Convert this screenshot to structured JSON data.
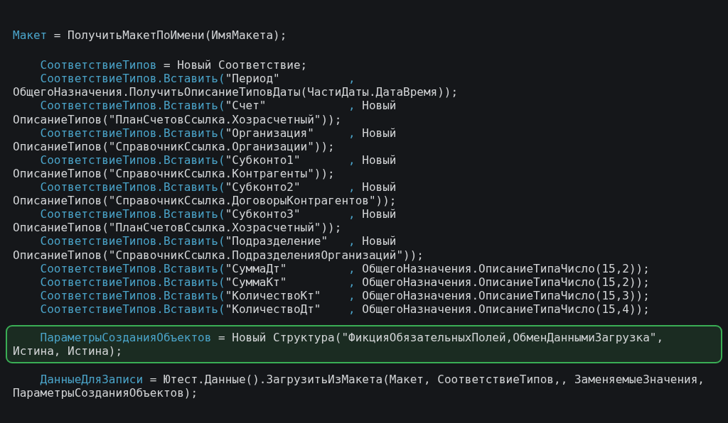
{
  "code_blocks": [
    {
      "highlighted": false,
      "lines": [
        {
          "indent": false,
          "segments": [
            {
              "kind": "ident",
              "text": "Макет"
            },
            {
              "kind": "plain",
              "text": " = ПолучитьМакетПоИмени(ИмяМакета);"
            }
          ]
        }
      ]
    },
    {
      "highlighted": false,
      "lines": [
        {
          "indent": true,
          "segments": [
            {
              "kind": "ident",
              "text": "СоответствиеТипов"
            },
            {
              "kind": "plain",
              "text": " = Новый Соответствие;"
            }
          ]
        },
        {
          "indent": true,
          "segments": [
            {
              "kind": "ident",
              "text": "СоответствиеТипов.Вставить("
            },
            {
              "kind": "plain",
              "text": "\"Период\"          "
            },
            {
              "kind": "ident",
              "text": ","
            }
          ]
        },
        {
          "indent": false,
          "segments": [
            {
              "kind": "plain",
              "text": "ОбщегоНазначения.ПолучитьОписаниеТиповДаты(ЧастиДаты.ДатаВремя));"
            }
          ]
        },
        {
          "indent": true,
          "segments": [
            {
              "kind": "ident",
              "text": "СоответствиеТипов.Вставить("
            },
            {
              "kind": "plain",
              "text": "\"Счет\"            "
            },
            {
              "kind": "ident",
              "text": ","
            },
            {
              "kind": "plain",
              "text": " Новый"
            }
          ]
        },
        {
          "indent": false,
          "segments": [
            {
              "kind": "plain",
              "text": "ОписаниеТипов(\"ПланСчетовСсылка.Хозрасчетный\"));"
            }
          ]
        },
        {
          "indent": true,
          "segments": [
            {
              "kind": "ident",
              "text": "СоответствиеТипов.Вставить("
            },
            {
              "kind": "plain",
              "text": "\"Организация\"     "
            },
            {
              "kind": "ident",
              "text": ","
            },
            {
              "kind": "plain",
              "text": " Новый"
            }
          ]
        },
        {
          "indent": false,
          "segments": [
            {
              "kind": "plain",
              "text": "ОписаниеТипов(\"СправочникСсылка.Организации\"));"
            }
          ]
        },
        {
          "indent": true,
          "segments": [
            {
              "kind": "ident",
              "text": "СоответствиеТипов.Вставить("
            },
            {
              "kind": "plain",
              "text": "\"Субконто1\"       "
            },
            {
              "kind": "ident",
              "text": ","
            },
            {
              "kind": "plain",
              "text": " Новый"
            }
          ]
        },
        {
          "indent": false,
          "segments": [
            {
              "kind": "plain",
              "text": "ОписаниеТипов(\"СправочникСсылка.Контрагенты\"));"
            }
          ]
        },
        {
          "indent": true,
          "segments": [
            {
              "kind": "ident",
              "text": "СоответствиеТипов.Вставить("
            },
            {
              "kind": "plain",
              "text": "\"Субконто2\"       "
            },
            {
              "kind": "ident",
              "text": ","
            },
            {
              "kind": "plain",
              "text": " Новый"
            }
          ]
        },
        {
          "indent": false,
          "segments": [
            {
              "kind": "plain",
              "text": "ОписаниеТипов(\"СправочникСсылка.ДоговорыКонтрагентов\"));"
            }
          ]
        },
        {
          "indent": true,
          "segments": [
            {
              "kind": "ident",
              "text": "СоответствиеТипов.Вставить("
            },
            {
              "kind": "plain",
              "text": "\"Субконто3\"       "
            },
            {
              "kind": "ident",
              "text": ","
            },
            {
              "kind": "plain",
              "text": " Новый"
            }
          ]
        },
        {
          "indent": false,
          "segments": [
            {
              "kind": "plain",
              "text": "ОписаниеТипов(\"ПланСчетовСсылка.Хозрасчетный\"));"
            }
          ]
        },
        {
          "indent": true,
          "segments": [
            {
              "kind": "ident",
              "text": "СоответствиеТипов.Вставить("
            },
            {
              "kind": "plain",
              "text": "\"Подразделение\"   "
            },
            {
              "kind": "ident",
              "text": ","
            },
            {
              "kind": "plain",
              "text": " Новый"
            }
          ]
        },
        {
          "indent": false,
          "segments": [
            {
              "kind": "plain",
              "text": "ОписаниеТипов(\"СправочникСсылка.ПодразделенияОрганизаций\"));"
            }
          ]
        },
        {
          "indent": true,
          "segments": [
            {
              "kind": "ident",
              "text": "СоответствиеТипов.Вставить("
            },
            {
              "kind": "plain",
              "text": "\"СуммаДт\"         "
            },
            {
              "kind": "ident",
              "text": ","
            },
            {
              "kind": "plain",
              "text": " ОбщегоНазначения.ОписаниеТипаЧисло(15,2));"
            }
          ]
        },
        {
          "indent": true,
          "segments": [
            {
              "kind": "ident",
              "text": "СоответствиеТипов.Вставить("
            },
            {
              "kind": "plain",
              "text": "\"СуммаКт\"         "
            },
            {
              "kind": "ident",
              "text": ","
            },
            {
              "kind": "plain",
              "text": " ОбщегоНазначения.ОписаниеТипаЧисло(15,2));"
            }
          ]
        },
        {
          "indent": true,
          "segments": [
            {
              "kind": "ident",
              "text": "СоответствиеТипов.Вставить("
            },
            {
              "kind": "plain",
              "text": "\"КоличествоКт\"    "
            },
            {
              "kind": "ident",
              "text": ","
            },
            {
              "kind": "plain",
              "text": " ОбщегоНазначения.ОписаниеТипаЧисло(15,3));"
            }
          ]
        },
        {
          "indent": true,
          "segments": [
            {
              "kind": "ident",
              "text": "СоответствиеТипов.Вставить("
            },
            {
              "kind": "plain",
              "text": "\"КоличествоДт\"    "
            },
            {
              "kind": "ident",
              "text": ","
            },
            {
              "kind": "plain",
              "text": " ОбщегоНазначения.ОписаниеТипаЧисло(15,4));"
            }
          ]
        }
      ]
    },
    {
      "highlighted": true,
      "lines": [
        {
          "indent": true,
          "segments": [
            {
              "kind": "ident",
              "text": "ПараметрыСозданияОбъектов"
            },
            {
              "kind": "plain",
              "text": " = Новый Структура(\"ФикцияОбязательныхПолей,ОбменДаннымиЗагрузка\","
            }
          ]
        },
        {
          "indent": false,
          "segments": [
            {
              "kind": "plain",
              "text": "Истина, Истина);"
            }
          ]
        }
      ]
    },
    {
      "highlighted": false,
      "lines": [
        {
          "indent": true,
          "segments": [
            {
              "kind": "ident",
              "text": "ДанныеДляЗаписи"
            },
            {
              "kind": "plain",
              "text": " = Ютест.Данные().ЗагрузитьИзМакета(Макет, СоответствиеТипов,, ЗаменяемыеЗначения,"
            }
          ]
        },
        {
          "indent": false,
          "segments": [
            {
              "kind": "plain",
              "text": "ПараметрыСозданияОбъектов);"
            }
          ]
        }
      ]
    }
  ]
}
